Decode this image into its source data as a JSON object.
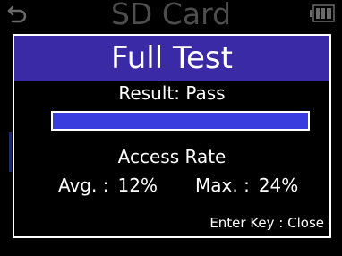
{
  "header": {
    "title": "SD Card",
    "back_icon": "return-arrow-icon",
    "battery_icon": "battery-icon"
  },
  "dialog": {
    "title": "Full Test",
    "result_text": "Result: Pass",
    "progress": 1.0,
    "access_rate_label": "Access Rate",
    "avg_label": "Avg. :",
    "avg_value": "12%",
    "max_label": "Max. :",
    "max_value": "24%",
    "footer_hint": "Enter Key : Close"
  },
  "colors": {
    "title_bar": "#3a2aa6",
    "progress_fill": "#3a3dde",
    "text": "#ffffff",
    "dim_text": "#4d4d4d",
    "background": "#000000"
  }
}
